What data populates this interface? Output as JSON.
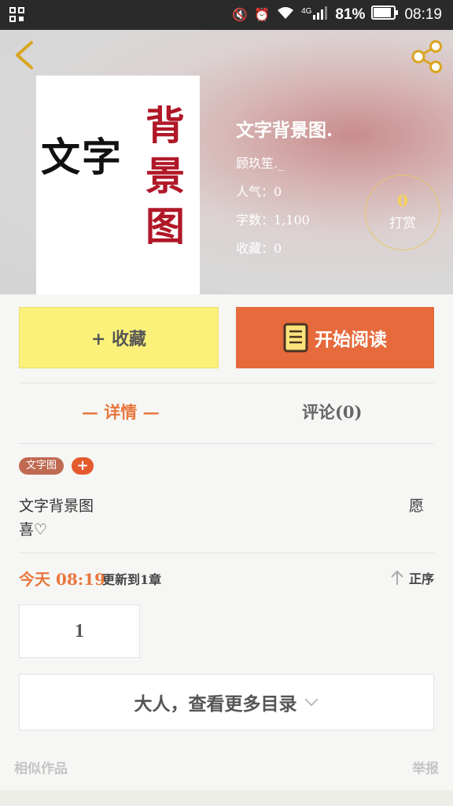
{
  "status_bar": {
    "battery": "81%",
    "time": "08:19",
    "network": "4G"
  },
  "book": {
    "cover_line1": "文字",
    "cover_line2": "背景图",
    "title": "文字背景图.",
    "author": "顾玖笙._",
    "popularity": "人气：0",
    "word_count": "字数：1,100",
    "favorites": "收藏：0"
  },
  "reward": {
    "count": "0",
    "label": "打赏"
  },
  "actions": {
    "favorite": "+ 收藏",
    "read": "开始阅读"
  },
  "tabs": {
    "detail": "— 详情 —",
    "comment": "评论(0)"
  },
  "tags": [
    "文字图"
  ],
  "tag_add": "+",
  "description": {
    "line1": "文字背景图",
    "line2": "喜♡",
    "right": "愿"
  },
  "update": {
    "time": "今天 08:19",
    "text": "更新到1章",
    "order": "正序"
  },
  "chapter": "1",
  "more_catalog": "大人，查看更多目录",
  "footer": {
    "similar": "相似作品",
    "report": "举报"
  },
  "colors": {
    "accent": "#e8773f",
    "read_button": "#e66a3c",
    "favorite_button": "#fbf17a",
    "cover_red": "#b01727"
  }
}
